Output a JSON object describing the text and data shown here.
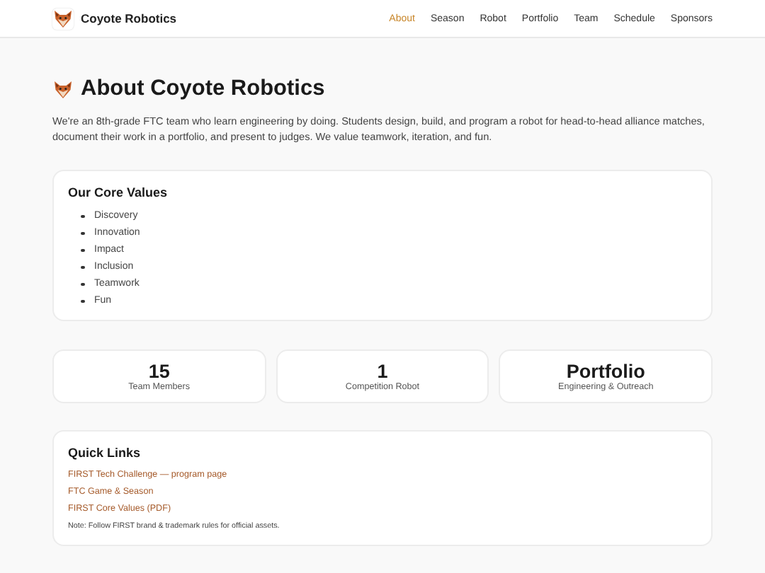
{
  "header": {
    "brand": "Coyote Robotics",
    "nav": [
      {
        "label": "About",
        "selected": true
      },
      {
        "label": "Season",
        "selected": false
      },
      {
        "label": "Robot",
        "selected": false
      },
      {
        "label": "Portfolio",
        "selected": false
      },
      {
        "label": "Team",
        "selected": false
      },
      {
        "label": "Schedule",
        "selected": false
      },
      {
        "label": "Sponsors",
        "selected": false
      }
    ]
  },
  "page": {
    "title": "About Coyote Robotics",
    "intro": "We're an 8th-grade FTC team who learn engineering by doing. Students design, build, and program a robot for head-to-head alliance matches, document their work in a portfolio, and present to judges. We value teamwork, iteration, and fun."
  },
  "core_values": {
    "title": "Our Core Values",
    "items": [
      "Discovery",
      "Innovation",
      "Impact",
      "Inclusion",
      "Teamwork",
      "Fun"
    ]
  },
  "stats": [
    {
      "value": "15",
      "label": "Team Members"
    },
    {
      "value": "1",
      "label": "Competition Robot"
    },
    {
      "value": "Portfolio",
      "label": "Engineering & Outreach"
    }
  ],
  "quick_links": {
    "title": "Quick Links",
    "links": [
      "FIRST Tech Challenge — program page",
      "FTC Game & Season",
      "FIRST Core Values (PDF)"
    ],
    "note": "Note: Follow FIRST brand & trademark rules for official assets."
  }
}
